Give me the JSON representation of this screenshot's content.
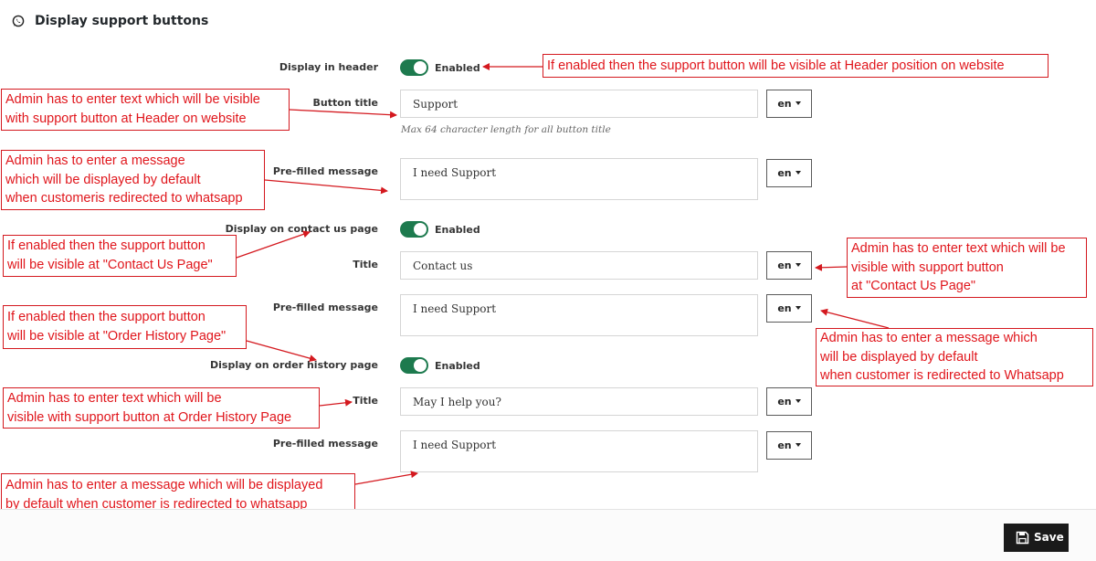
{
  "section": {
    "title": "Display support buttons",
    "icon": "whatsapp-icon"
  },
  "header": {
    "display_label": "Display in header",
    "toggle_state": "Enabled",
    "button_title_label": "Button title",
    "button_title_value": "Support",
    "button_title_lang": "en",
    "help_text": "Max 64 character length for all button title",
    "prefilled_label": "Pre-filled message",
    "prefilled_value": "I need Support",
    "prefilled_lang": "en"
  },
  "contact_us": {
    "display_label": "Display on contact us page",
    "toggle_state": "Enabled",
    "title_label": "Title",
    "title_value": "Contact us",
    "title_lang": "en",
    "prefilled_label": "Pre-filled message",
    "prefilled_value": "I need Support",
    "prefilled_lang": "en"
  },
  "order_history": {
    "display_label": "Display on order history page",
    "toggle_state": "Enabled",
    "title_label": "Title",
    "title_value": "May I help you?",
    "title_lang": "en",
    "prefilled_label": "Pre-filled message",
    "prefilled_value": "I need Support",
    "prefilled_lang": "en"
  },
  "annotations": {
    "header_toggle": [
      "If enabled then the support button will be visible at Header position on website"
    ],
    "header_title": [
      "Admin has to enter text which will be visible",
      "with support button at Header on website"
    ],
    "header_message": [
      "Admin has to enter a message",
      "which will be displayed by default",
      "when customeris redirected to whatsapp"
    ],
    "contact_toggle": [
      "If enabled then the support button",
      "will be visible at \"Contact Us Page\""
    ],
    "contact_title": [
      "Admin has to enter text which will be",
      "visible with support button",
      "at \"Contact Us Page\""
    ],
    "order_toggle": [
      "If enabled then the support button",
      "will be visible at \"Order History Page\""
    ],
    "contact_message": [
      "Admin has to enter a message which",
      "will be displayed by default",
      "when customer is redirected to Whatsapp"
    ],
    "order_title": [
      "Admin has to enter text which will be",
      "visible with support button at Order History Page"
    ],
    "order_message": [
      "Admin has to enter a message which will be displayed",
      "by default when customer is redirected to whatsapp"
    ]
  },
  "footer": {
    "save_label": "Save",
    "save_icon": "floppy-disk-icon"
  },
  "colors": {
    "annotation_red": "#e0161c",
    "toggle_green": "#1d7a4e",
    "save_bg": "#1a1a1a"
  }
}
